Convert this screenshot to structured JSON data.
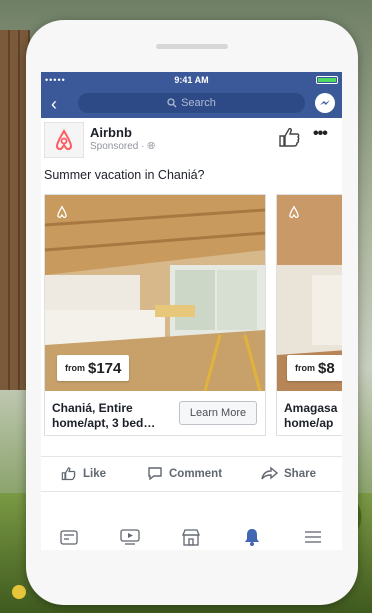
{
  "status": {
    "signal": "•••••",
    "time": "9:41 AM"
  },
  "nav": {
    "search_placeholder": "Search"
  },
  "post": {
    "advertiser": "Airbnb",
    "sponsored": "Sponsored · ",
    "caption": "Summer vacation in Chaniá?",
    "cards": [
      {
        "from": "from",
        "price": "$174",
        "title": "Chaniá, Entire home/apt, 3 bed…",
        "cta": "Learn More"
      },
      {
        "from": "from",
        "price": "$8",
        "title": "Amagasa home/ap"
      }
    ]
  },
  "actions": {
    "like": "Like",
    "comment": "Comment",
    "share": "Share"
  },
  "colors": {
    "facebook_blue": "#3b5998",
    "airbnb_red": "#ff5a5f",
    "active_tab": "#4267b2"
  },
  "tabs": [
    "feed-icon",
    "video-icon",
    "marketplace-icon",
    "notifications-icon",
    "menu-icon"
  ]
}
